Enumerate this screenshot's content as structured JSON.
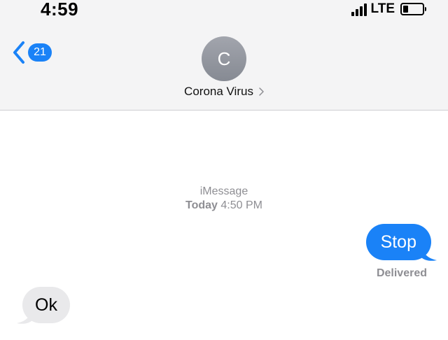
{
  "status_bar": {
    "time": "4:59",
    "carrier": "LTE",
    "signal_bars": 4,
    "battery_level": 0.25
  },
  "nav": {
    "back_badge": "21",
    "contact_initial": "C",
    "contact_name": "Corona Virus"
  },
  "conversation": {
    "service": "iMessage",
    "day": "Today",
    "time": "4:50 PM",
    "messages": [
      {
        "direction": "sent",
        "text": "Stop",
        "status": "Delivered"
      },
      {
        "direction": "received",
        "text": "Ok"
      }
    ]
  },
  "colors": {
    "accent": "#1a82f7",
    "received_bubble": "#e9e9eb",
    "secondary_text": "#8e8e93",
    "header_bg": "#f4f4f5",
    "avatar": "#8e9199"
  }
}
